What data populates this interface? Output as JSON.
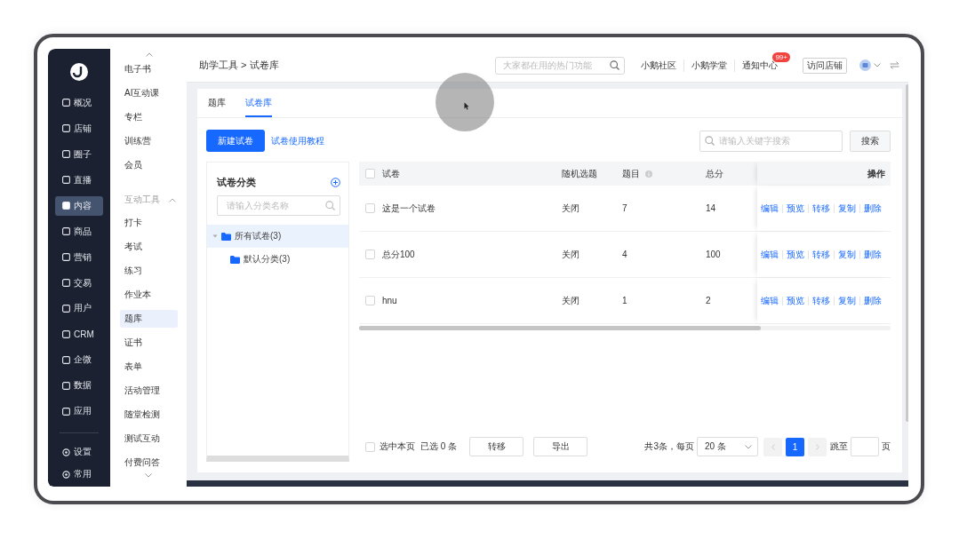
{
  "nav": {
    "items": [
      {
        "label": "概况",
        "selected": false
      },
      {
        "label": "店铺",
        "selected": false
      },
      {
        "label": "圈子",
        "selected": false
      },
      {
        "label": "直播",
        "selected": false
      },
      {
        "label": "内容",
        "selected": true
      },
      {
        "label": "商品",
        "selected": false
      },
      {
        "label": "营销",
        "selected": false
      },
      {
        "label": "交易",
        "selected": false
      },
      {
        "label": "用户",
        "selected": false
      },
      {
        "label": "CRM",
        "selected": false
      },
      {
        "label": "企微",
        "selected": false
      },
      {
        "label": "数据",
        "selected": false
      },
      {
        "label": "应用",
        "selected": false
      }
    ],
    "bottom": [
      {
        "label": "设置"
      },
      {
        "label": "常用"
      }
    ]
  },
  "submenu": {
    "items": [
      {
        "label": "电子书",
        "selected": false
      },
      {
        "label": "AI互动课",
        "selected": false
      },
      {
        "label": "专栏",
        "selected": false
      },
      {
        "label": "训练营",
        "selected": false
      },
      {
        "label": "会员",
        "selected": false
      }
    ],
    "group": {
      "label": "互动工具",
      "expanded": true,
      "items": [
        {
          "label": "打卡",
          "selected": false
        },
        {
          "label": "考试",
          "selected": false
        },
        {
          "label": "练习",
          "selected": false
        },
        {
          "label": "作业本",
          "selected": false
        },
        {
          "label": "题库",
          "selected": true
        },
        {
          "label": "证书",
          "selected": false
        },
        {
          "label": "表单",
          "selected": false
        },
        {
          "label": "活动管理",
          "selected": false
        },
        {
          "label": "随堂检测",
          "selected": false
        },
        {
          "label": "测试互动",
          "selected": false
        },
        {
          "label": "付费问答",
          "selected": false
        }
      ]
    }
  },
  "topbar": {
    "breadcrumb": "助学工具 > 试卷库",
    "search": {
      "placeholder": "大家都在用的热门功能"
    },
    "links": [
      {
        "label": "小鹅社区"
      },
      {
        "label": "小鹅学堂"
      },
      {
        "label": "通知中心",
        "badge": "99+"
      }
    ],
    "button": "访问店铺"
  },
  "tabs": [
    {
      "label": "题库",
      "selected": false
    },
    {
      "label": "试卷库",
      "selected": true
    }
  ],
  "toolbar": {
    "primary": "新建试卷",
    "link": "试卷使用教程",
    "search": {
      "placeholder": "请输入关键字搜索"
    },
    "search_button": "搜索"
  },
  "categories": {
    "title": "试卷分类",
    "placeholder": "请输入分类名称",
    "tree": [
      {
        "label": "所有试卷(3)",
        "expanded": true,
        "selected": true,
        "children": [
          {
            "label": "默认分类(3)",
            "selected": false
          }
        ]
      }
    ]
  },
  "table": {
    "select_all_checked": false,
    "columns": [
      {
        "label": "试卷"
      },
      {
        "label": "随机选题"
      },
      {
        "label": "题目",
        "info": true
      },
      {
        "label": "总分"
      },
      {
        "label": "操作"
      }
    ],
    "rows": [
      {
        "checked": false,
        "name": "这是一个试卷",
        "random": "关闭",
        "questions": "7",
        "score": "14",
        "actions": [
          "编辑",
          "预览",
          "转移",
          "复制",
          "删除"
        ]
      },
      {
        "checked": false,
        "name": "总分100",
        "random": "关闭",
        "questions": "4",
        "score": "100",
        "actions": [
          "编辑",
          "预览",
          "转移",
          "复制",
          "删除"
        ]
      },
      {
        "checked": false,
        "name": "hnu",
        "random": "关闭",
        "questions": "1",
        "score": "2",
        "actions": [
          "编辑",
          "预览",
          "转移",
          "复制",
          "删除"
        ]
      }
    ]
  },
  "footer": {
    "select_page": {
      "label": "选中本页",
      "checked": false
    },
    "selected_count": "已选 0 条",
    "buttons": [
      "转移",
      "导出"
    ],
    "total": "共3条，每页",
    "page_size": "20 条",
    "pages": [
      {
        "label": "1",
        "selected": true
      }
    ],
    "jump_label": "跳至",
    "jump_suffix": "页"
  }
}
